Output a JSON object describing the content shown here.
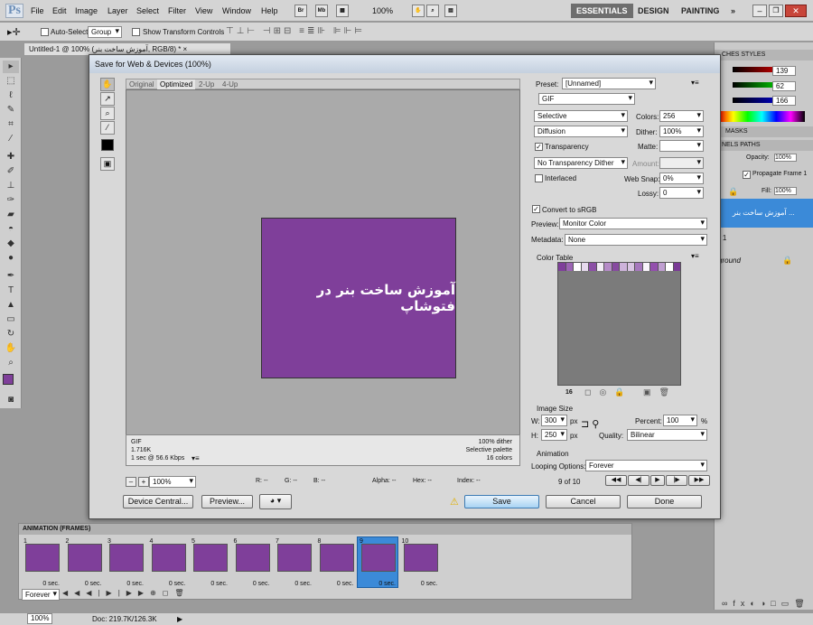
{
  "menubar": {
    "logo": "Ps",
    "items": [
      "File",
      "Edit",
      "Image",
      "Layer",
      "Select",
      "Filter",
      "View",
      "Window",
      "Help"
    ],
    "icons": [
      "Br",
      "Mb"
    ],
    "zoom": "100%",
    "workspaces": {
      "essentials": "ESSENTIALS",
      "design": "DESIGN",
      "painting": "PAINTING",
      "more": "»"
    }
  },
  "options": {
    "auto_select": "Auto-Select:",
    "auto_select_value": "Group",
    "show_transform": "Show Transform Controls"
  },
  "doc_tab": "Untitled-1 @ 100% (آموزش ساخت بنر, RGB/8) * ×",
  "dialog": {
    "title": "Save for Web & Devices (100%)",
    "tabs": [
      "Original",
      "Optimized",
      "2-Up",
      "4-Up"
    ],
    "banner_text": "آموزش ساخت بنر در فتوشاپ",
    "info_left": [
      "GIF",
      "1.716K",
      "1 sec @ 56.6 Kbps"
    ],
    "info_right": [
      "100% dither",
      "Selective palette",
      "16 colors"
    ],
    "zoom": "100%",
    "readouts": [
      "R: --",
      "G: --",
      "B: --",
      "Alpha: --",
      "Hex: --",
      "Index: --"
    ],
    "preset_label": "Preset:",
    "preset_value": "[Unnamed]",
    "format": "GIF",
    "reduction": "Selective",
    "colors_label": "Colors:",
    "colors_value": "256",
    "dither_algo": "Diffusion",
    "dither_label": "Dither:",
    "dither_value": "100%",
    "transparency": "Transparency",
    "matte_label": "Matte:",
    "trans_dither": "No Transparency Dither",
    "amount_label": "Amount:",
    "interlaced": "Interlaced",
    "websnap_label": "Web Snap:",
    "websnap_value": "0%",
    "lossy_label": "Lossy:",
    "lossy_value": "0",
    "convert_srgb": "Convert to sRGB",
    "preview_label": "Preview:",
    "preview_value": "Monitor Color",
    "metadata_label": "Metadata:",
    "metadata_value": "None",
    "color_table_title": "Color Table",
    "color_count": "16",
    "image_size": "Image Size",
    "w_label": "W:",
    "w_value": "300",
    "h_label": "H:",
    "h_value": "250",
    "px": "px",
    "percent_label": "Percent:",
    "percent_value": "100",
    "percent_unit": "%",
    "quality_label": "Quality:",
    "quality_value": "Bilinear",
    "animation_title": "Animation",
    "looping_label": "Looping Options:",
    "looping_value": "Forever",
    "frame_count": "9 of 10",
    "buttons": {
      "device_central": "Device Central...",
      "preview": "Preview...",
      "save": "Save",
      "cancel": "Cancel",
      "done": "Done"
    }
  },
  "right_panel": {
    "tabs": "CHES STYLES",
    "values": [
      "139",
      "62",
      "166"
    ],
    "masks": "MASKS",
    "channels": "NELS PATHS",
    "opacity_label": "Opacity:",
    "opacity_value": "100%",
    "propagate": "Propagate Frame 1",
    "fill_label": "Fill:",
    "fill_value": "100%",
    "layer_text": "آموزش ساخت بنر ...",
    "layer1": "r 1",
    "background": "ground"
  },
  "animation": {
    "title": "ANIMATION (FRAMES)",
    "loop": "Forever",
    "frames": [
      {
        "num": "1",
        "delay": "0 sec."
      },
      {
        "num": "2",
        "delay": "0 sec."
      },
      {
        "num": "3",
        "delay": "0 sec."
      },
      {
        "num": "4",
        "delay": "0 sec."
      },
      {
        "num": "5",
        "delay": "0 sec."
      },
      {
        "num": "6",
        "delay": "0 sec."
      },
      {
        "num": "7",
        "delay": "0 sec."
      },
      {
        "num": "8",
        "delay": "0 sec."
      },
      {
        "num": "9",
        "delay": "0 sec."
      },
      {
        "num": "10",
        "delay": "0 sec."
      }
    ]
  },
  "status": {
    "zoom": "100%",
    "doc": "Doc: 219.7K/126.3K"
  },
  "colors": {
    "purple": "#7f3f9a",
    "accent": "#3b8ad8"
  }
}
